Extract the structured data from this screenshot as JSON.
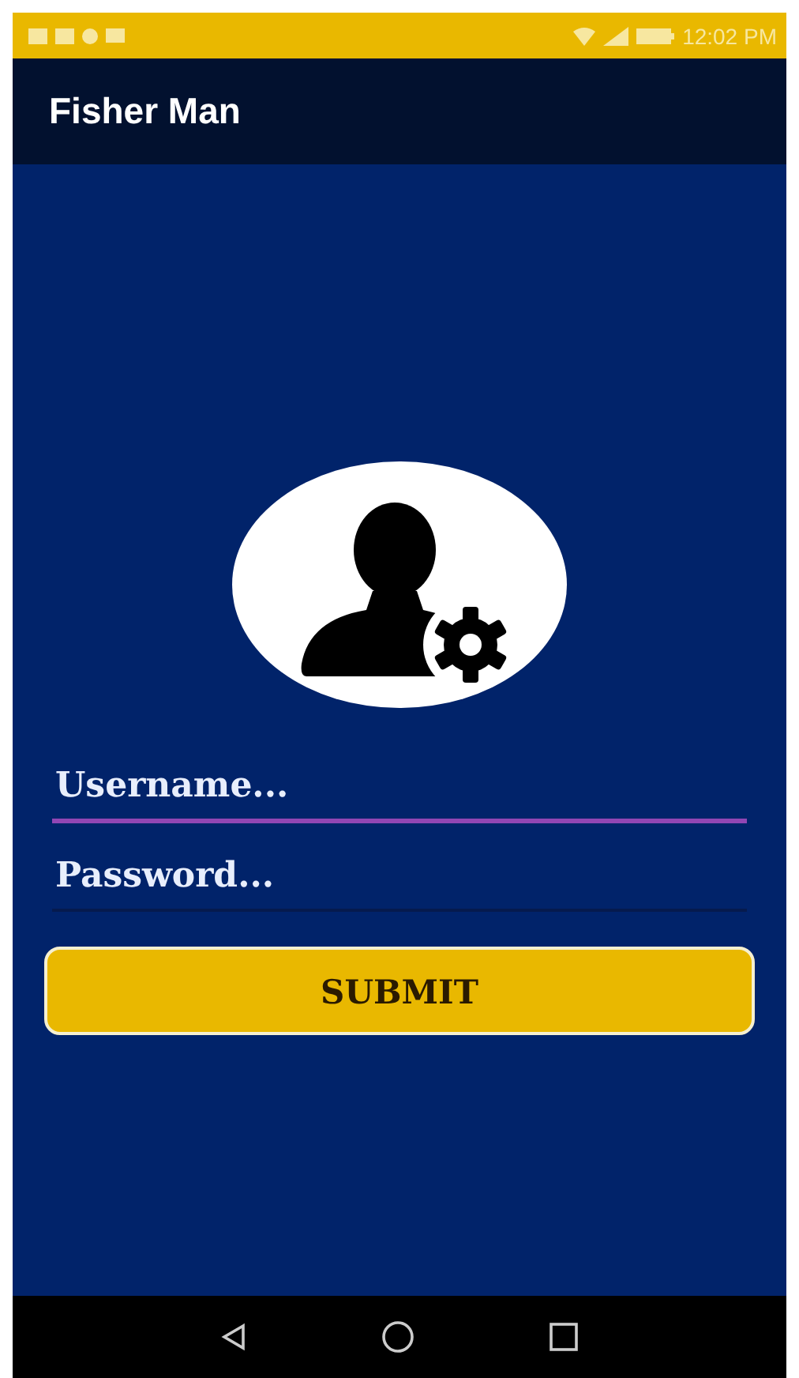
{
  "status_bar": {
    "time": "12:02 PM"
  },
  "app_bar": {
    "title": "Fisher Man"
  },
  "form": {
    "fields": [
      {
        "placeholder": "Username...",
        "focused": true
      },
      {
        "placeholder": "Password...",
        "focused": false
      }
    ],
    "submit": "SUBMIT"
  }
}
